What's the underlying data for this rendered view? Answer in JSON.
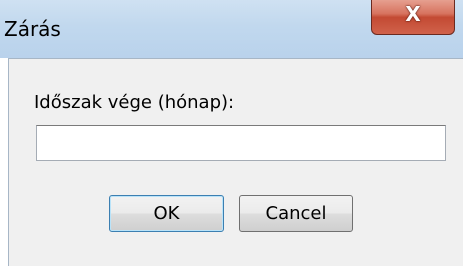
{
  "window": {
    "title": "Zárás",
    "close_glyph": "X"
  },
  "form": {
    "prompt_label": "Időszak vége (hónap):",
    "field_value": "",
    "field_placeholder": ""
  },
  "buttons": {
    "ok_label": "OK",
    "cancel_label": "Cancel"
  },
  "icons": {
    "close": "close-icon"
  },
  "colors": {
    "titlebar": "#c1d8ee",
    "close_button": "#c34a33",
    "client_background": "#f0f0f0",
    "default_button_border": "#3c7fb1"
  }
}
